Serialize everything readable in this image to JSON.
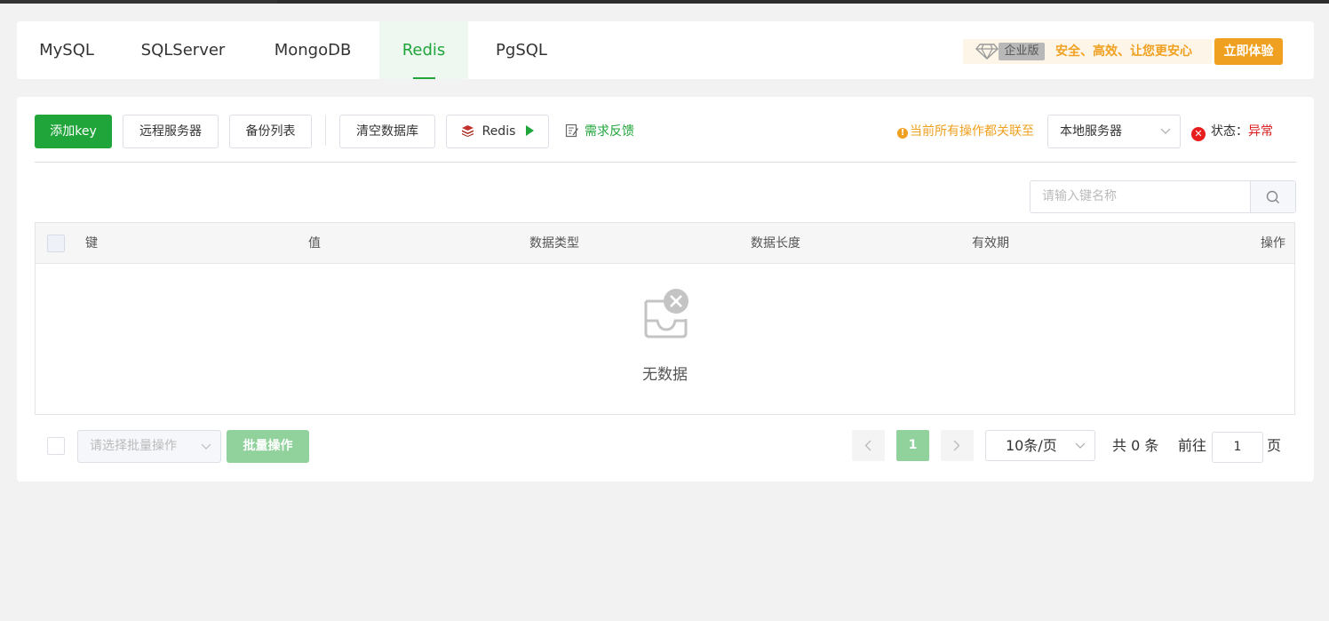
{
  "tabs": [
    {
      "label": "MySQL",
      "active": false
    },
    {
      "label": "SQLServer",
      "active": false
    },
    {
      "label": "MongoDB",
      "active": false
    },
    {
      "label": "Redis",
      "active": true
    },
    {
      "label": "PgSQL",
      "active": false
    }
  ],
  "promo": {
    "edition_badge": "企业版",
    "slogan": "安全、高效、让您更安心",
    "try_button": "立即体验"
  },
  "toolbar": {
    "add_key": "添加key",
    "remote_server": "远程服务器",
    "backup_list": "备份列表",
    "clear_db": "清空数据库",
    "redis_button": "Redis",
    "feedback": "需求反馈",
    "server_note": "当前所有操作都关联至",
    "server_select": "本地服务器",
    "status_label": "状态：",
    "status_value": "异常"
  },
  "search": {
    "placeholder": "请输入键名称"
  },
  "table": {
    "columns": [
      "键",
      "值",
      "数据类型",
      "数据长度",
      "有效期",
      "操作"
    ],
    "empty_text": "无数据"
  },
  "footer": {
    "bulk_select_placeholder": "请选择批量操作",
    "bulk_button": "批量操作",
    "current_page": "1",
    "per_page": "10条/页",
    "total": "共 0 条",
    "goto_label": "前往",
    "goto_value": "1",
    "page_unit": "页"
  },
  "colors": {
    "accent": "#20a53a",
    "warning": "#f0a020",
    "error": "#d91a1a"
  }
}
